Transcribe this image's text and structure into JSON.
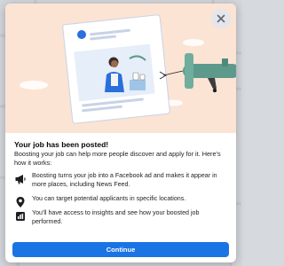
{
  "dialog": {
    "title": "Your job has been posted!",
    "subtitle": "Boosting your job can help more people discover and apply for it. Here's how it works:",
    "close_icon": "close-icon",
    "features": [
      {
        "icon": "megaphone-icon",
        "text": "Boosting turns your job into a Facebook ad and makes it appear in more places, including News Feed."
      },
      {
        "icon": "location-pin-icon",
        "text": "You can target potential applicants in specific locations."
      },
      {
        "icon": "insights-chart-icon",
        "text": "You'll have access to insights and see how your boosted job performed."
      }
    ],
    "continue_label": "Continue"
  },
  "colors": {
    "accent": "#1b74e4",
    "hero_background": "#fbe4d4",
    "illustration_green": "#5d9a8b",
    "illustration_blue": "#2a6fdb"
  }
}
